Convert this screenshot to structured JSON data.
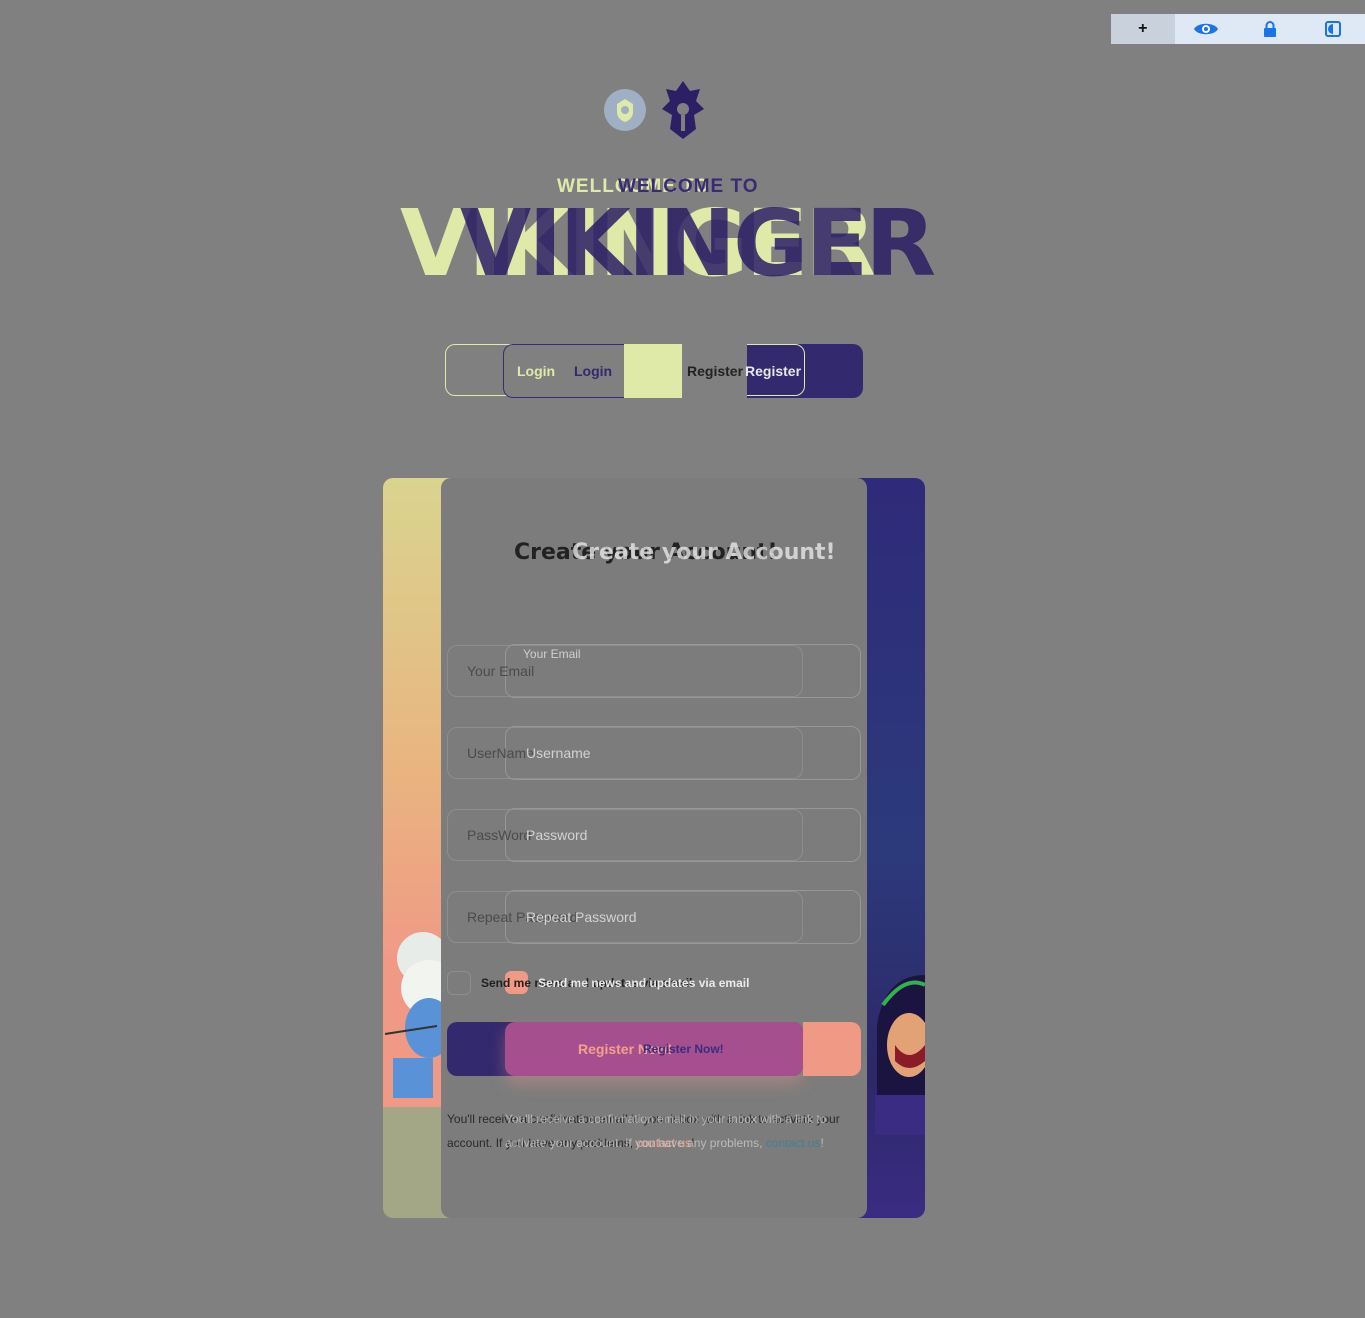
{
  "toolbar": {
    "items": [
      {
        "icon": "plus-icon",
        "label": "+"
      },
      {
        "icon": "eye-icon",
        "label": ""
      },
      {
        "icon": "lock-icon",
        "label": ""
      },
      {
        "icon": "contrast-icon",
        "label": ""
      }
    ]
  },
  "header": {
    "welcome_light": "WELLCOME TO",
    "welcome_dark": "WELCOME TO",
    "brand_light": "VIKINGER",
    "brand_dark": "VIKINGER"
  },
  "tabs": {
    "login_light": "Login",
    "login_dark": "Login",
    "register_dark": "Register",
    "register_light": "Register"
  },
  "form": {
    "title_dark": "Create your Account!",
    "title_light": "Create your Account!",
    "email_label": "Your Email",
    "email_placeholder": "Your Email",
    "username_placeholder_a": "UserName",
    "username_placeholder_b": "Username",
    "password_placeholder_a": "PassWord",
    "password_placeholder_b": "Password",
    "repeat_placeholder_a": "Repeat Password",
    "repeat_placeholder_b": "Repeat Password",
    "newsletter_a": "Send me news and updates via email",
    "newsletter_b": "Send me news and updates via email",
    "register_a": "Register Now!",
    "register_b": "Register Now!",
    "note_a_prefix": "You'll receive a confirmation email in your inbox with a link to activate your account. If you have any problems, ",
    "note_a_link": "contact us",
    "note_a_suffix": "!",
    "note_b_prefix": "You'll receive a confirmation email in your inbox with a link to activate your account. If you have any problems, ",
    "note_b_link": "contact us",
    "note_b_suffix": "!"
  },
  "colors": {
    "accent_yellow": "#dfe9a8",
    "accent_purple": "#33296e",
    "accent_salmon": "#f09a86",
    "button_magenta": "#a64f8e"
  }
}
